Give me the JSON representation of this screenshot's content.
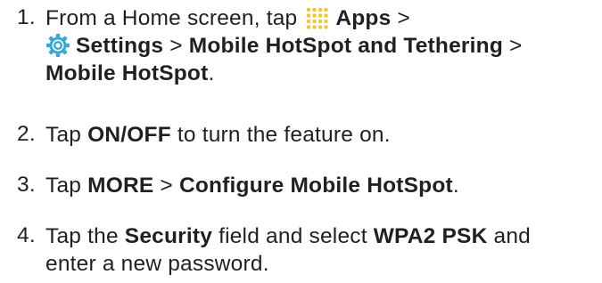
{
  "steps": [
    {
      "number": "1.",
      "lines": [
        {
          "text1": "From a Home screen, tap ",
          "bold1": "Apps",
          "text2": " >"
        },
        {
          "bold1": "Settings",
          "text2": " > ",
          "bold2": "Mobile HotSpot and Tethering",
          "text3": " >"
        },
        {
          "bold1": "Mobile HotSpot",
          "text2": "."
        }
      ],
      "icons": [
        "apps-grid-icon",
        "settings-gear-icon"
      ]
    },
    {
      "number": "2.",
      "lines": [
        {
          "text1": "Tap ",
          "bold1": "ON/OFF",
          "text2": " to turn the feature on."
        }
      ]
    },
    {
      "number": "3.",
      "lines": [
        {
          "text1": "Tap ",
          "bold1": "MORE",
          "text2": " > ",
          "bold2": "Configure Mobile HotSpot",
          "text3": "."
        }
      ]
    },
    {
      "number": "4.",
      "lines": [
        {
          "text1": "Tap the ",
          "bold1": "Security",
          "text2": " field and select ",
          "bold2": "WPA2 PSK",
          "text3": " and"
        },
        {
          "text1": "enter a new password."
        }
      ]
    }
  ],
  "colors": {
    "text": "#231f20",
    "apps_icon": "#f2c42e",
    "settings_icon": "#3aa6d6"
  }
}
